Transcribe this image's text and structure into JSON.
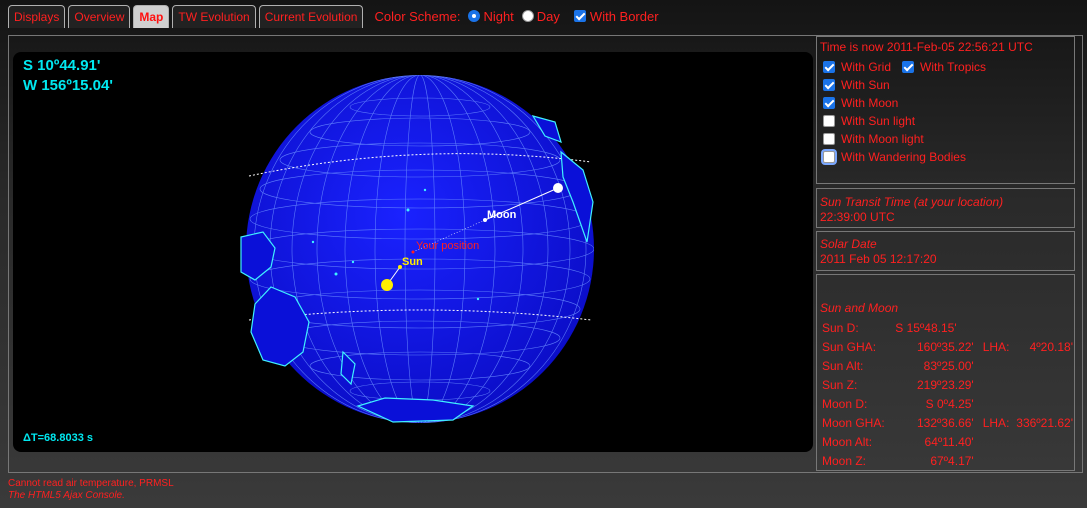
{
  "tabs": [
    "Displays",
    "Overview",
    "Map",
    "TW Evolution",
    "Current Evolution"
  ],
  "color_scheme": {
    "label": "Color Scheme:",
    "options": [
      "Night",
      "Day"
    ],
    "selected": "Night"
  },
  "with_border": {
    "label": "With Border",
    "checked": true
  },
  "map": {
    "lat": "S 10º44.91'",
    "lon": "W 156º15.04'",
    "delta_t": "ΔT=68.8033 s",
    "labels": {
      "moon": "Moon",
      "sun": "Sun",
      "position": "Your position"
    }
  },
  "time_now": "Time is now 2011-Feb-05 22:56:21 UTC",
  "options": {
    "with_grid": {
      "label": "With Grid",
      "checked": true
    },
    "with_tropics": {
      "label": "With Tropics",
      "checked": true
    },
    "with_sun": {
      "label": "With Sun",
      "checked": true
    },
    "with_moon": {
      "label": "With Moon",
      "checked": true
    },
    "with_sun_light": {
      "label": "With Sun light",
      "checked": false
    },
    "with_moon_light": {
      "label": "With Moon light",
      "checked": false
    },
    "with_wandering": {
      "label": "With Wandering Bodies",
      "checked": false
    }
  },
  "transit": {
    "title": "Sun Transit Time (at your location)",
    "value": "22:39:00 UTC"
  },
  "solar_date": {
    "title": "Solar Date",
    "value": "2011 Feb 05 12:17:20"
  },
  "sun_moon": {
    "title": "Sun and Moon",
    "sun_d": {
      "label": "Sun D:",
      "value": "S 15º48.15'"
    },
    "sun_gha": {
      "label": "Sun GHA:",
      "value": "160º35.22'",
      "lha_label": "LHA:",
      "lha": "4º20.18'"
    },
    "sun_alt": {
      "label": "Sun Alt:",
      "value": "83º25.00'"
    },
    "sun_z": {
      "label": "Sun Z:",
      "value": "219º23.29'"
    },
    "moon_d": {
      "label": "Moon D:",
      "value": "S 0º4.25'"
    },
    "moon_gha": {
      "label": "Moon GHA:",
      "value": "132º36.66'",
      "lha_label": "LHA:",
      "lha": "336º21.62'"
    },
    "moon_alt": {
      "label": "Moon Alt:",
      "value": "64º11.40'"
    },
    "moon_z": {
      "label": "Moon Z:",
      "value": "67º4.17'"
    }
  },
  "footer": {
    "error": "Cannot read air temperature, PRMSL",
    "console": "The HTML5 Ajax Console."
  },
  "colors": {
    "accent": "#ff2020",
    "coord": "#00e8f0",
    "globe": "#0a10d8",
    "sun": "#ffee00"
  }
}
